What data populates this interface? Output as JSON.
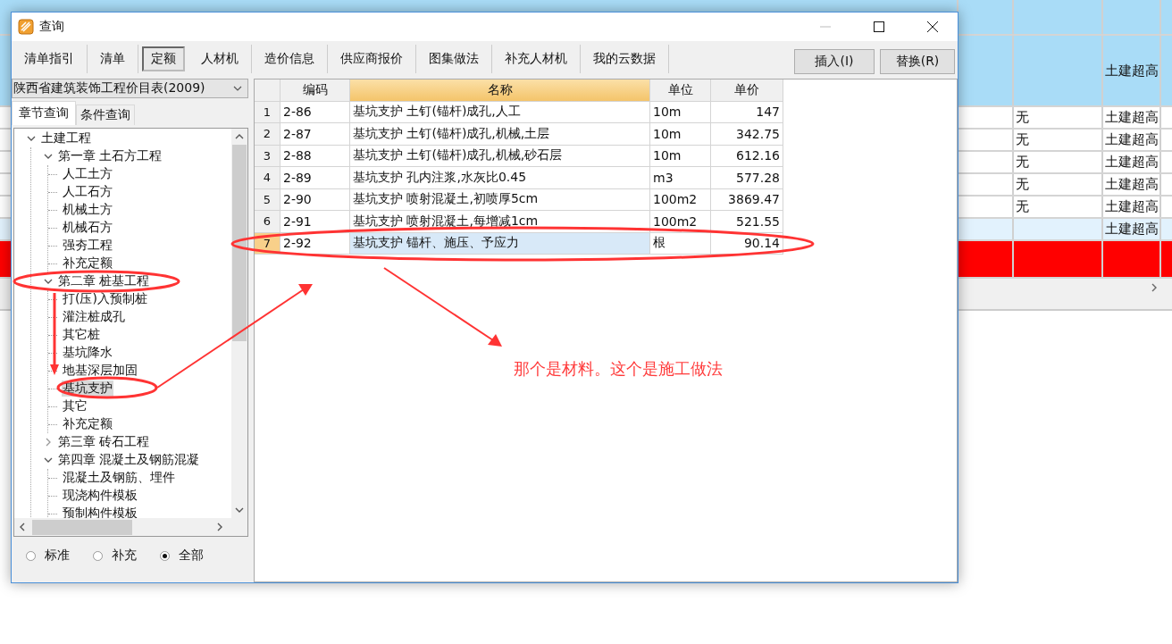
{
  "background_sheet": {
    "rows": [
      {
        "kind": "group"
      },
      {
        "kind": "group",
        "column_c": "土建超高"
      },
      {
        "kind": "item",
        "column_b": "无",
        "column_c": "土建超高"
      },
      {
        "kind": "item",
        "column_b": "无",
        "column_c": "土建超高"
      },
      {
        "kind": "item",
        "column_b": "无",
        "column_c": "土建超高"
      },
      {
        "kind": "item",
        "column_b": "无",
        "column_c": "土建超高"
      },
      {
        "kind": "item",
        "column_b": "无",
        "column_c": "土建超高"
      },
      {
        "kind": "current",
        "column_c": "土建超高"
      },
      {
        "kind": "error"
      }
    ]
  },
  "window": {
    "title": "查询"
  },
  "tabs": [
    {
      "label": "清单指引",
      "selected": false
    },
    {
      "label": "清单",
      "selected": false
    },
    {
      "label": "定额",
      "selected": true
    },
    {
      "label": "人材机",
      "selected": false
    },
    {
      "label": "造价信息",
      "selected": false
    },
    {
      "label": "供应商报价",
      "selected": false
    },
    {
      "label": "图集做法",
      "selected": false
    },
    {
      "label": "补充人材机",
      "selected": false
    },
    {
      "label": "我的云数据",
      "selected": false
    }
  ],
  "buttons": [
    "插入(I)",
    "替换(R)"
  ],
  "library_select": {
    "value": "陕西省建筑装饰工程价目表(2009)"
  },
  "search_tabs": [
    {
      "label": "章节查询",
      "selected": true
    },
    {
      "label": "条件查询",
      "selected": false
    }
  ],
  "tree": [
    {
      "label": "土建工程",
      "expanded": true,
      "selected": false,
      "children": [
        {
          "label": "第一章  土石方工程",
          "expanded": true,
          "selected": false,
          "children": [
            {
              "label": "人工土方",
              "selected": false
            },
            {
              "label": "人工石方",
              "selected": false
            },
            {
              "label": "机械土方",
              "selected": false
            },
            {
              "label": "机械石方",
              "selected": false
            },
            {
              "label": "强夯工程",
              "selected": false
            },
            {
              "label": "补充定额",
              "selected": false
            }
          ]
        },
        {
          "label": "第二章  桩基工程",
          "expanded": true,
          "selected": false,
          "children": [
            {
              "label": "打(压)入预制桩",
              "selected": false
            },
            {
              "label": "灌注桩成孔",
              "selected": false
            },
            {
              "label": "其它桩",
              "selected": false
            },
            {
              "label": "基坑降水",
              "selected": false
            },
            {
              "label": "地基深层加固",
              "selected": false
            },
            {
              "label": "基坑支护",
              "selected": true
            },
            {
              "label": "其它",
              "selected": false
            },
            {
              "label": "补充定额",
              "selected": false
            }
          ]
        },
        {
          "label": "第三章  砖石工程",
          "expanded": false,
          "selected": false
        },
        {
          "label": "第四章  混凝土及钢筋混凝",
          "expanded": true,
          "selected": false,
          "children": [
            {
              "label": "混凝土及钢筋、埋件",
              "selected": false
            },
            {
              "label": "现浇构件模板",
              "selected": false
            },
            {
              "label": "预制构件模板",
              "selected": false
            }
          ]
        }
      ]
    }
  ],
  "filter_options": [
    {
      "label": "标准",
      "selected": false
    },
    {
      "label": "补充",
      "selected": false
    },
    {
      "label": "全部",
      "selected": true
    }
  ],
  "table": {
    "columns": [
      {
        "label": "编码",
        "selected": false
      },
      {
        "label": "名称",
        "selected": true
      },
      {
        "label": "单位",
        "selected": false
      },
      {
        "label": "单价",
        "selected": false
      }
    ],
    "rows": [
      {
        "index": "1",
        "code": "2-86",
        "name": "基坑支护 土钉(锚杆)成孔,人工",
        "unit": "10m",
        "price": "147",
        "selected": false
      },
      {
        "index": "2",
        "code": "2-87",
        "name": "基坑支护 土钉(锚杆)成孔,机械,土层",
        "unit": "10m",
        "price": "342.75",
        "selected": false
      },
      {
        "index": "3",
        "code": "2-88",
        "name": "基坑支护 土钉(锚杆)成孔,机械,砂石层",
        "unit": "10m",
        "price": "612.16",
        "selected": false
      },
      {
        "index": "4",
        "code": "2-89",
        "name": "基坑支护 孔内注浆,水灰比0.45",
        "unit": "m3",
        "price": "577.28",
        "selected": false
      },
      {
        "index": "5",
        "code": "2-90",
        "name": "基坑支护 喷射混凝土,初喷厚5cm",
        "unit": "100m2",
        "price": "3869.47",
        "selected": false
      },
      {
        "index": "6",
        "code": "2-91",
        "name": "基坑支护 喷射混凝土,每增减1cm",
        "unit": "100m2",
        "price": "521.55",
        "selected": false
      },
      {
        "index": "7",
        "code": "2-92",
        "name": "基坑支护 锚杆、施压、予应力",
        "unit": "根",
        "price": "90.14",
        "selected": true
      }
    ]
  },
  "annotation": {
    "note": "那个是材料。这个是施工做法"
  }
}
